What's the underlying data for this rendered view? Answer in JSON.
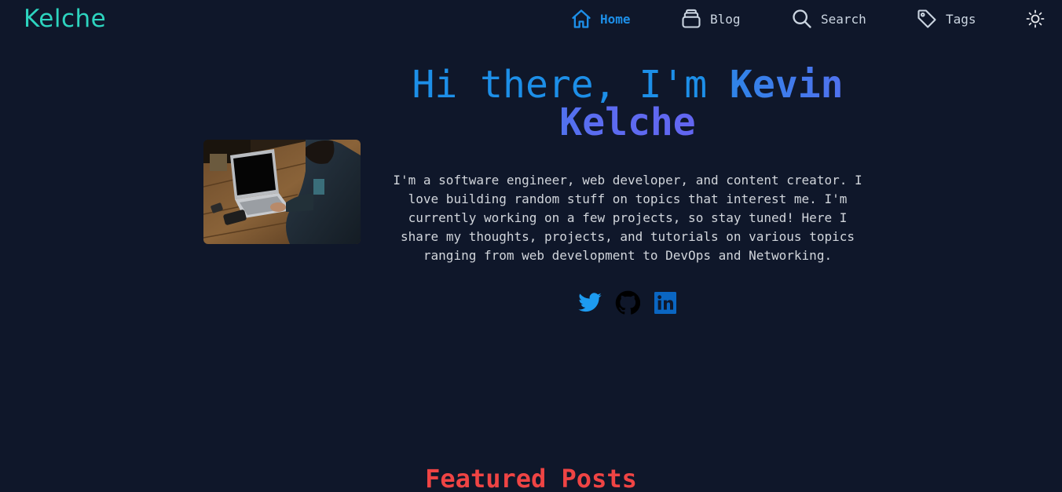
{
  "header": {
    "logo": "Kelche",
    "nav": [
      {
        "label": "Home",
        "icon": "home-icon",
        "active": true
      },
      {
        "label": "Blog",
        "icon": "blog-icon",
        "active": false
      },
      {
        "label": "Search",
        "icon": "search-icon",
        "active": false
      },
      {
        "label": "Tags",
        "icon": "tag-icon",
        "active": false
      }
    ],
    "theme_toggle_icon": "sun-icon"
  },
  "hero": {
    "greeting": "Hi there, I'm ",
    "name": "Kevin Kelche",
    "bio": "I'm a software engineer, web developer, and content creator. I love building random stuff on topics that interest me. I'm currently working on a few projects, so stay tuned! Here I share my thoughts, projects, and tutorials on various topics ranging from web development to DevOps and Networking.",
    "image_icon": "laptop-photo",
    "social": [
      {
        "icon": "twitter-icon",
        "color": "#1d9bf0"
      },
      {
        "icon": "github-icon",
        "color": "#000000"
      },
      {
        "icon": "linkedin-icon",
        "color": "#0a66c2"
      }
    ]
  },
  "featured": {
    "title": "Featured Posts"
  },
  "colors": {
    "background": "#0f172a",
    "logo": "#2dd4bf",
    "nav_active": "#1d8fe8",
    "greeting": "#1d8fe8",
    "featured_title": "#ef4444"
  }
}
